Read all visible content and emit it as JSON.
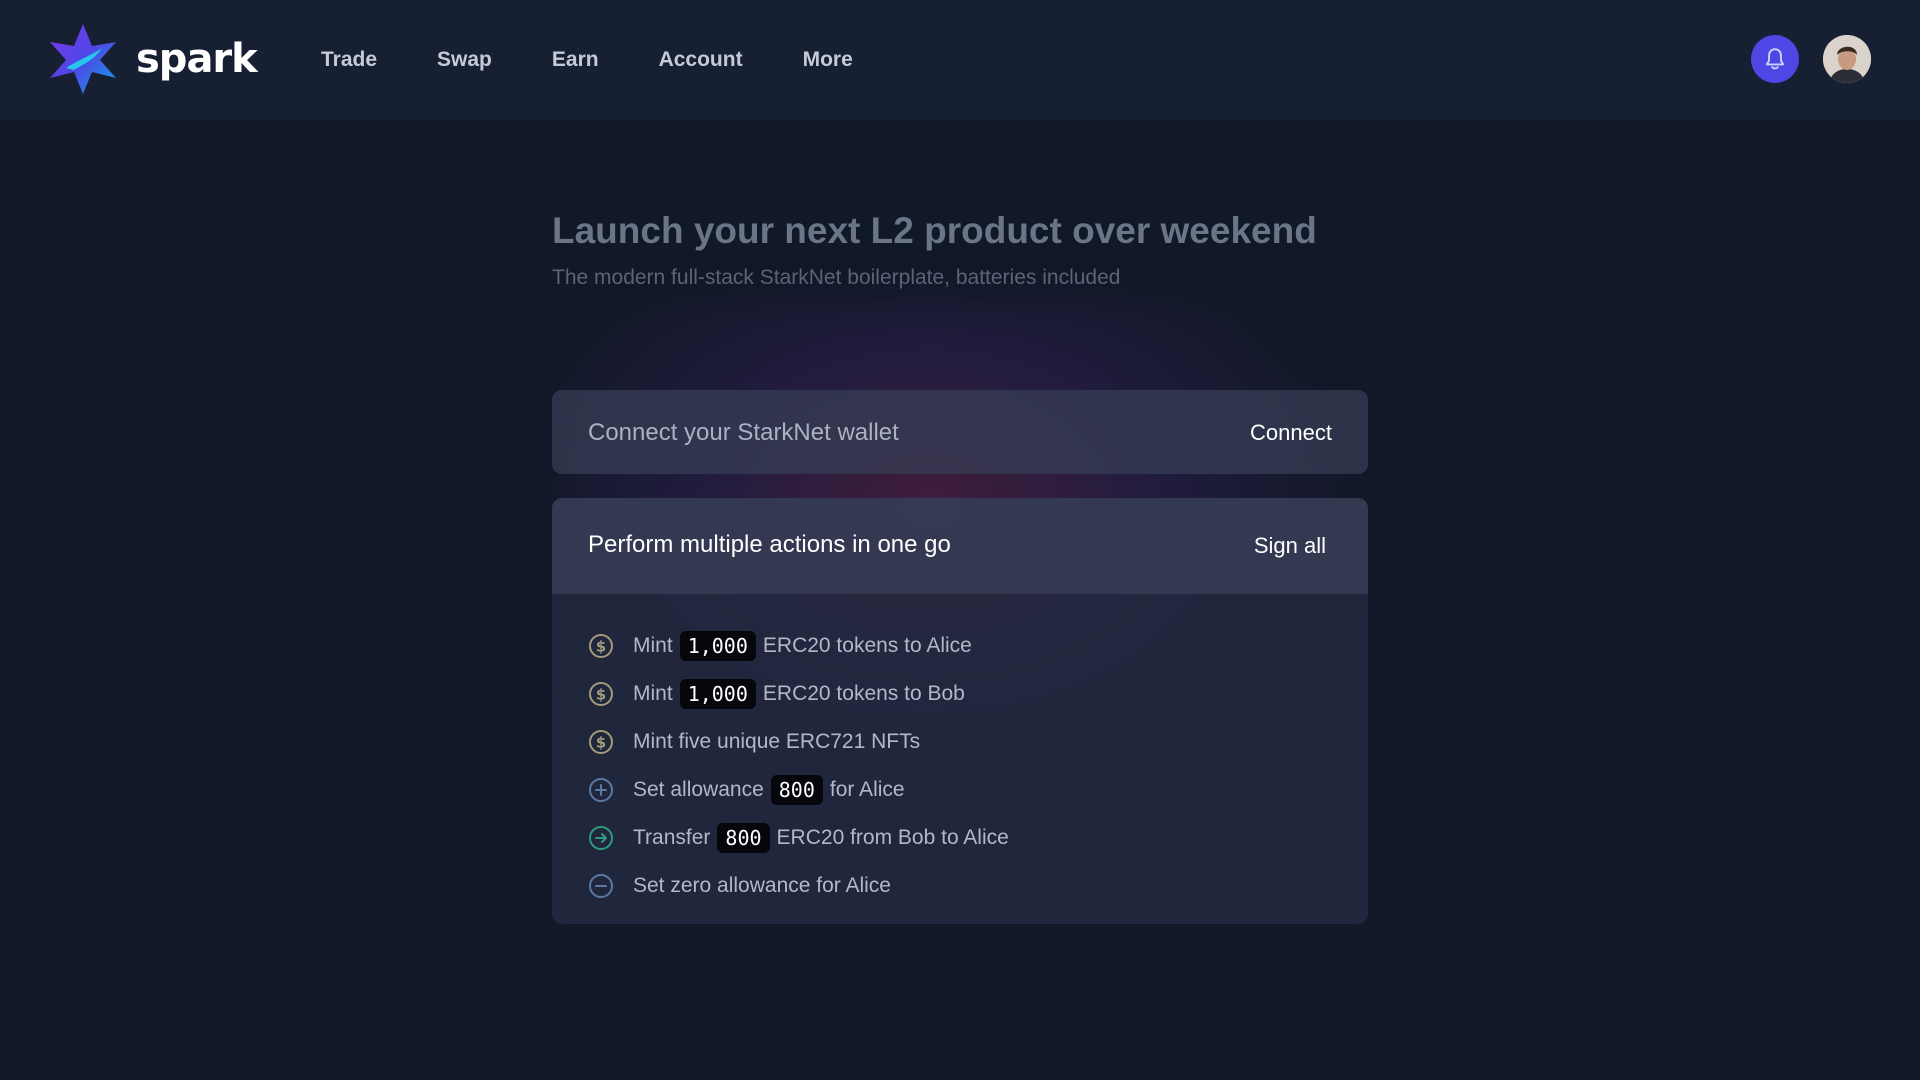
{
  "brand": {
    "name": "spark"
  },
  "nav": {
    "items": [
      "Trade",
      "Swap",
      "Earn",
      "Account",
      "More"
    ]
  },
  "header": {
    "notification_icon": "bell-icon",
    "avatar_icon": "user-avatar"
  },
  "hero": {
    "title": "Launch your next L2 product over weekend",
    "subtitle": "The modern full-stack StarkNet boilerplate, batteries included"
  },
  "wallet": {
    "label": "Connect your StarkNet wallet",
    "button": "Connect"
  },
  "actions": {
    "title": "Perform multiple actions in one go",
    "button": "Sign all",
    "items": [
      {
        "icon": "dollar-icon",
        "before": "Mint",
        "amount": "1,000",
        "after": "ERC20 tokens to Alice"
      },
      {
        "icon": "dollar-icon",
        "before": "Mint",
        "amount": "1,000",
        "after": "ERC20 tokens to Bob"
      },
      {
        "icon": "dollar-icon",
        "before": "Mint five unique ERC721 NFTs"
      },
      {
        "icon": "plus-circle-icon",
        "before": "Set allowance",
        "amount": "800",
        "after": "for Alice"
      },
      {
        "icon": "arrow-right-circle-icon",
        "before": "Transfer",
        "amount": "800",
        "after": "ERC20 from Bob to Alice"
      },
      {
        "icon": "minus-circle-icon",
        "before": "Set zero allowance for Alice"
      }
    ]
  },
  "colors": {
    "background": "#111827",
    "header": "#172033",
    "accent": "#4f46e5",
    "dollar_icon": "#a39a78",
    "plus_icon": "#5d78a6",
    "arrow_icon": "#2f9a80",
    "minus_icon": "#5d78a6"
  }
}
